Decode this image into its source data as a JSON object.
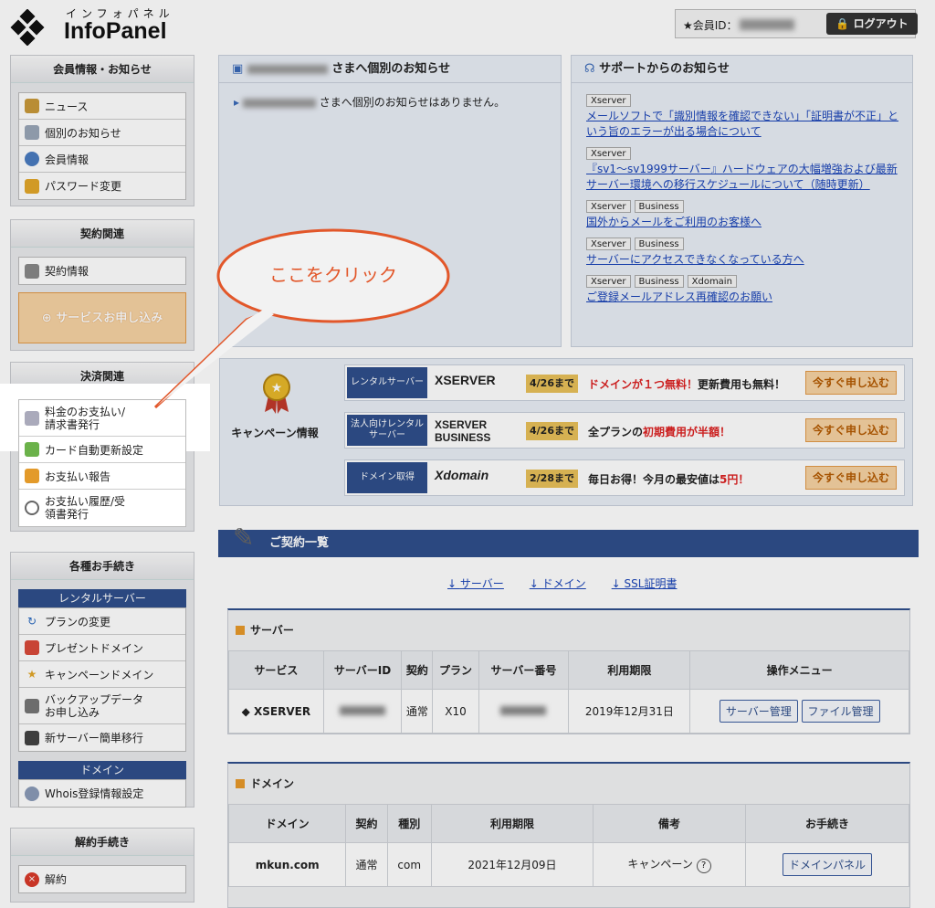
{
  "header": {
    "logo_kana": "インフォパネル",
    "logo_text": "InfoPanel",
    "member_label": "★会員ID：",
    "logout_label": "ログアウト"
  },
  "sidebar": {
    "member": {
      "title": "会員情報・お知らせ",
      "items": [
        "ニュース",
        "個別のお知らせ",
        "会員情報",
        "パスワード変更"
      ]
    },
    "contract": {
      "title": "契約関連",
      "items": [
        "契約情報"
      ],
      "apply_button": "サービスお申し込み"
    },
    "payment": {
      "title": "決済関連",
      "items": [
        "料金のお支払い/請求書発行",
        "カード自動更新設定",
        "お支払い報告",
        "お支払い履歴/受領書発行"
      ]
    },
    "procedures": {
      "title": "各種お手続き",
      "sub_rental": "レンタルサーバー",
      "rental_items": [
        "プランの変更",
        "プレゼントドメイン",
        "キャンペーンドメイン",
        "バックアップデータお申し込み",
        "新サーバー簡単移行"
      ],
      "sub_domain": "ドメイン",
      "domain_items": [
        "Whois登録情報設定"
      ]
    },
    "cancel": {
      "title": "解約手続き",
      "items": [
        "解約"
      ]
    }
  },
  "personal": {
    "title": "さまへ個別のお知らせ",
    "message": "さまへ個別のお知らせはありません。"
  },
  "support": {
    "title": "サポートからのお知らせ",
    "items": [
      {
        "tags": [
          "Xserver"
        ],
        "text": "メールソフトで「識別情報を確認できない」「証明書が不正」という旨のエラーが出る場合について"
      },
      {
        "tags": [
          "Xserver"
        ],
        "text": "『sv1～sv1999サーバー』ハードウェアの大幅増強および最新サーバー環境への移行スケジュールについて（随時更新）"
      },
      {
        "tags": [
          "Xserver",
          "Business"
        ],
        "text": "国外からメールをご利用のお客様へ"
      },
      {
        "tags": [
          "Xserver",
          "Business"
        ],
        "text": "サーバーにアクセスできなくなっている方へ"
      },
      {
        "tags": [
          "Xserver",
          "Business",
          "Xdomain"
        ],
        "text": "ご登録メールアドレス再確認のお願い"
      }
    ]
  },
  "campaign": {
    "label": "キャンペーン情報",
    "rows": [
      {
        "category": "レンタルサーバー",
        "brand": "XSERVER",
        "date": "4/26まで",
        "msg_red": "ドメインが１つ無料！",
        "msg": "更新費用も無料！",
        "button": "今すぐ申し込む"
      },
      {
        "category": "法人向けレンタルサーバー",
        "brand": "XSERVER BUSINESS",
        "date": "4/26まで",
        "msg_pre": "全プランの",
        "msg_red": "初期費用が半額！",
        "button": "今すぐ申し込む"
      },
      {
        "category": "ドメイン取得",
        "brand": "Xdomain",
        "date": "2/28まで",
        "msg": "毎日お得！今月の最安値は",
        "msg_red": "5円！",
        "button": "今すぐ申し込む"
      }
    ]
  },
  "contracts": {
    "title": "ご契約一覧",
    "links": [
      "サーバー",
      "ドメイン",
      "SSL証明書"
    ],
    "server": {
      "title": "サーバー",
      "headers": [
        "サービス",
        "サーバーID",
        "契約",
        "プラン",
        "サーバー番号",
        "利用期限",
        "操作メニュー"
      ],
      "row": {
        "service": "XSERVER",
        "contract": "通常",
        "plan": "X10",
        "expiry": "2019年12月31日",
        "btn1": "サーバー管理",
        "btn2": "ファイル管理"
      }
    },
    "domain": {
      "title": "ドメイン",
      "headers": [
        "ドメイン",
        "契約",
        "種別",
        "利用期限",
        "備考",
        "お手続き"
      ],
      "row": {
        "domain": "mkun.com",
        "contract": "通常",
        "type": "com",
        "expiry": "2021年12月09日",
        "note": "キャンペーン",
        "btn": "ドメインパネル"
      }
    }
  },
  "callout_text": "ここをクリック"
}
